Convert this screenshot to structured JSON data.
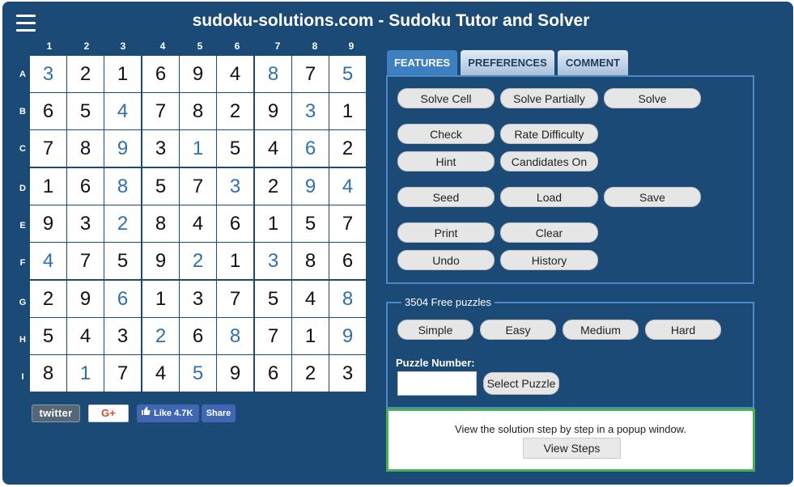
{
  "header": {
    "title": "sudoku-solutions.com - Sudoku Tutor and Solver",
    "menu_icon": "hamburger-menu-icon"
  },
  "board": {
    "column_labels": [
      "1",
      "2",
      "3",
      "4",
      "5",
      "6",
      "7",
      "8",
      "9"
    ],
    "row_labels": [
      "A",
      "B",
      "C",
      "D",
      "E",
      "F",
      "G",
      "H",
      "I"
    ],
    "grid": [
      [
        "3",
        "2",
        "1",
        "6",
        "9",
        "4",
        "8",
        "7",
        "5"
      ],
      [
        "6",
        "5",
        "4",
        "7",
        "8",
        "2",
        "9",
        "3",
        "1"
      ],
      [
        "7",
        "8",
        "9",
        "3",
        "1",
        "5",
        "4",
        "6",
        "2"
      ],
      [
        "1",
        "6",
        "8",
        "5",
        "7",
        "3",
        "2",
        "9",
        "4"
      ],
      [
        "9",
        "3",
        "2",
        "8",
        "4",
        "6",
        "1",
        "5",
        "7"
      ],
      [
        "4",
        "7",
        "5",
        "9",
        "2",
        "1",
        "3",
        "8",
        "6"
      ],
      [
        "2",
        "9",
        "6",
        "1",
        "3",
        "7",
        "5",
        "4",
        "8"
      ],
      [
        "5",
        "4",
        "3",
        "2",
        "6",
        "8",
        "7",
        "1",
        "9"
      ],
      [
        "8",
        "1",
        "7",
        "4",
        "5",
        "9",
        "6",
        "2",
        "3"
      ]
    ],
    "solved_mask": [
      [
        1,
        0,
        0,
        0,
        0,
        0,
        1,
        0,
        1
      ],
      [
        0,
        0,
        1,
        0,
        0,
        0,
        0,
        1,
        0
      ],
      [
        0,
        0,
        1,
        0,
        1,
        0,
        0,
        1,
        0
      ],
      [
        0,
        0,
        1,
        0,
        0,
        1,
        0,
        1,
        1
      ],
      [
        0,
        0,
        1,
        0,
        0,
        0,
        0,
        0,
        0
      ],
      [
        1,
        0,
        0,
        0,
        1,
        0,
        1,
        0,
        0
      ],
      [
        0,
        0,
        1,
        0,
        0,
        0,
        0,
        0,
        1
      ],
      [
        0,
        0,
        0,
        1,
        0,
        1,
        0,
        0,
        1
      ],
      [
        0,
        1,
        0,
        0,
        1,
        0,
        0,
        0,
        0
      ]
    ],
    "given_color": "#111111",
    "solved_color": "#2f6fb0"
  },
  "social": {
    "twitter": "twitter",
    "gplus": "G+",
    "fb_like": "Like 4.7K",
    "fb_share": "Share"
  },
  "tabs": [
    {
      "label": "FEATURES",
      "active": true
    },
    {
      "label": "PREFERENCES",
      "active": false
    },
    {
      "label": "COMMENT",
      "active": false
    }
  ],
  "features": {
    "solve_cell": "Solve Cell",
    "solve_partially": "Solve Partially",
    "solve": "Solve",
    "check": "Check",
    "rate_difficulty": "Rate Difficulty",
    "hint": "Hint",
    "candidates_on": "Candidates On",
    "seed": "Seed",
    "load": "Load",
    "save": "Save",
    "print": "Print",
    "clear": "Clear",
    "undo": "Undo",
    "history": "History"
  },
  "puzzles": {
    "legend": "3504 Free puzzles",
    "simple": "Simple",
    "easy": "Easy",
    "medium": "Medium",
    "hard": "Hard",
    "number_label": "Puzzle Number:",
    "number_value": "",
    "select": "Select Puzzle"
  },
  "steps": {
    "text": "View the solution step by step in a popup window.",
    "button": "View Steps"
  },
  "colors": {
    "background": "#1c4a76",
    "panel_border": "#4a8ac6",
    "active_tab": "#3d7fbf",
    "highlight_border": "#4caf50"
  }
}
